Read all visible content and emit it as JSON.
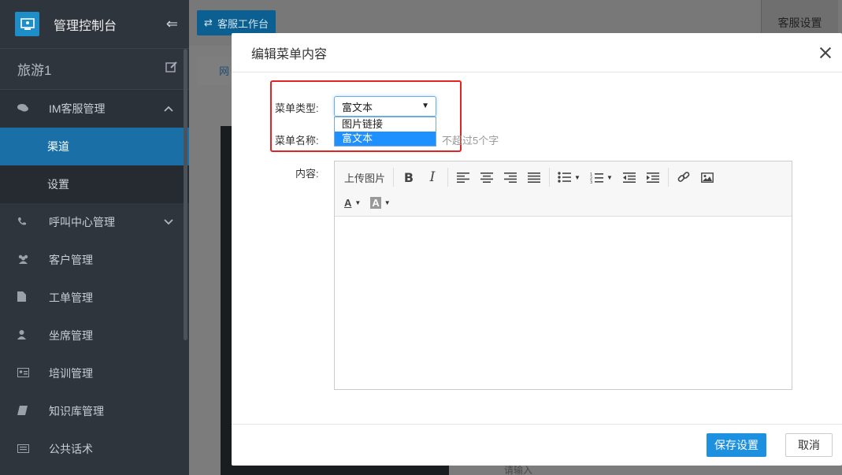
{
  "sidebar": {
    "app_title": "管理控制台",
    "tenant_name": "旅游1",
    "items": [
      {
        "icon": "chat-icon",
        "label": "IM客服管理",
        "expanded": true
      },
      {
        "label": "渠道",
        "active": true
      },
      {
        "label": "设置"
      },
      {
        "icon": "phone-icon",
        "label": "呼叫中心管理"
      },
      {
        "icon": "users-icon",
        "label": "客户管理"
      },
      {
        "icon": "file-icon",
        "label": "工单管理"
      },
      {
        "icon": "user-icon",
        "label": "坐席管理"
      },
      {
        "icon": "id-card-icon",
        "label": "培训管理"
      },
      {
        "icon": "book-icon",
        "label": "知识库管理"
      },
      {
        "icon": "keyboard-icon",
        "label": "公共话术"
      }
    ]
  },
  "topbar": {
    "workbench_label": "客服工作台",
    "settings_tab": "客服设置",
    "bg_tab_partial": "网",
    "bg_input_placeholder": "请输入"
  },
  "modal": {
    "title": "编辑菜单内容",
    "menu_type_label": "菜单类型:",
    "menu_type_value": "富文本",
    "menu_type_options": [
      "图片链接",
      "富文本"
    ],
    "menu_name_label": "菜单名称:",
    "menu_name_hint": "不超过5个字",
    "content_label": "内容:",
    "toolbar": {
      "upload_image": "上传图片",
      "bold": "B",
      "italic": "I",
      "font_color": "A",
      "bg_color": "A"
    },
    "save_label": "保存设置",
    "cancel_label": "取消"
  },
  "colors": {
    "sidebar_bg": "#2f353d",
    "active_item": "#1b6fa7",
    "primary_button": "#1e90e0",
    "highlight_border": "#e02424"
  }
}
